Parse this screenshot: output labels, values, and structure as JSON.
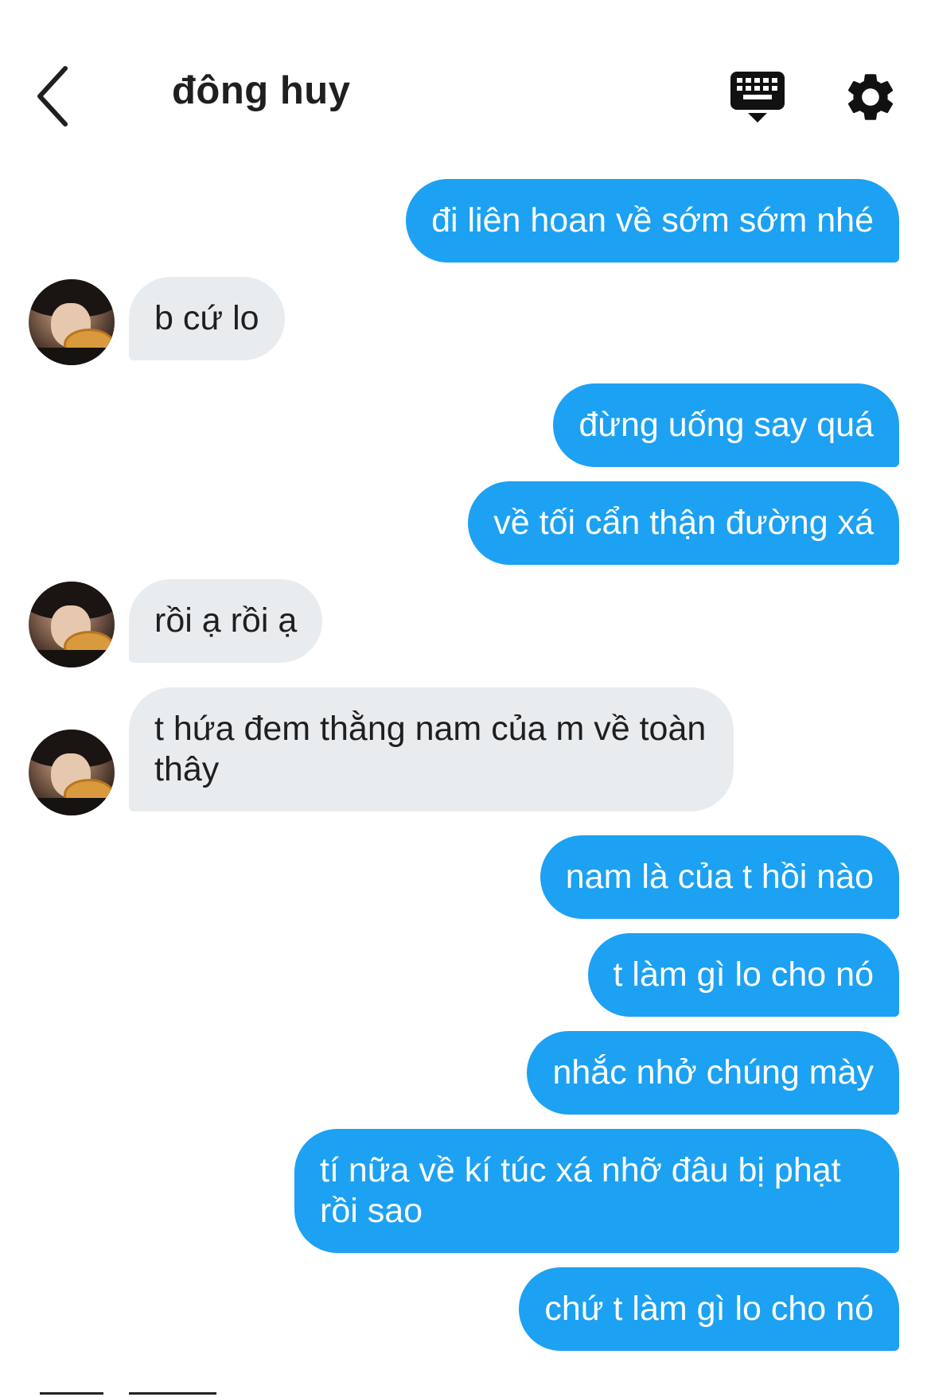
{
  "header": {
    "contact_name": "đông huy",
    "back_icon": "chevron-left-icon",
    "keyboard_icon": "keyboard-icon",
    "settings_icon": "gear-icon"
  },
  "colors": {
    "outgoing_bubble": "#1da1f2",
    "incoming_bubble": "#e9ecef",
    "outgoing_text": "#ffffff",
    "incoming_text": "#1f1f1f"
  },
  "messages": [
    {
      "direction": "outgoing",
      "text": "đi liên hoan về sớm sớm nhé"
    },
    {
      "direction": "incoming",
      "text": "b cứ lo"
    },
    {
      "direction": "outgoing",
      "text": "đừng uống say quá"
    },
    {
      "direction": "outgoing",
      "text": "về tối cẩn thận đường xá"
    },
    {
      "direction": "incoming",
      "text": "rồi ạ rồi ạ"
    },
    {
      "direction": "incoming",
      "text": "t hứa đem thằng nam của m về toàn thây"
    },
    {
      "direction": "outgoing",
      "text": "nam là của t hồi nào"
    },
    {
      "direction": "outgoing",
      "text": "t làm gì lo cho nó"
    },
    {
      "direction": "outgoing",
      "text": "nhắc nhở chúng mày"
    },
    {
      "direction": "outgoing",
      "text": "tí nữa về kí túc xá nhỡ đâu bị phạt rồi sao"
    },
    {
      "direction": "outgoing",
      "text": "chứ t làm gì lo cho nó"
    }
  ]
}
